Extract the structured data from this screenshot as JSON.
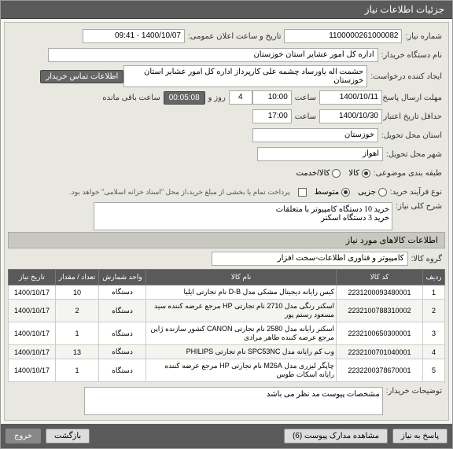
{
  "header": {
    "title": "جزئیات اطلاعات نیاز"
  },
  "fields": {
    "need_number_label": "شماره نیاز:",
    "need_number": "1100000261000082",
    "announce_label": "تاریخ و ساعت اعلان عمومی:",
    "announce_value": "1400/10/07 - 09:41",
    "buyer_org_label": "نام دستگاه خریدار:",
    "buyer_org": "اداره کل امور عشایر استان خوزستان",
    "requester_label": "ایجاد کننده درخواست:",
    "requester": "حشمت اله یاورساد چشمه علی کارپرداز اداره کل امور عشایر استان خوزستان",
    "contact_link": "اطلاعات تماس خریدار",
    "response_deadline_label": "مهلت ارسال پاسخ:",
    "response_date": "1400/10/11",
    "time_label": "ساعت",
    "response_time": "10:00",
    "days_label": "روز و",
    "days_value": "4",
    "remaining_time": "00:05:08",
    "remaining_label": "ساعت باقی مانده",
    "validity_label": "حداقل تاریخ اعتبار قیمت تا تاریخ:",
    "validity_date": "1400/10/30",
    "validity_time": "17:00",
    "province_label": "استان محل تحویل:",
    "province": "خوزستان",
    "city_label": "شهر محل تحویل:",
    "city": "اهواز",
    "category_label": "طبقه بندی موضوعی:",
    "cat_goods": "کالا",
    "cat_service": "کالا/خدمت",
    "purchase_type_label": "نوع فرآیند خرید:",
    "pt_small": "جزیی",
    "pt_medium": "متوسط",
    "pt_note": "پرداخت تمام یا بخشی از مبلغ خرید،از محل \"اسناد خزانه اسلامی\" خواهد بود.",
    "need_title_label": "شرح کلی نیاز:",
    "need_title": "خرید 10 دستگاه کامپیوتر با متعلقات\nخرید 3 دستگاه اسکنر",
    "items_header": "اطلاعات کالاهای مورد نیاز",
    "group_label": "گروه کالا:",
    "group_value": "کامپیوتر و فناوری اطلاعات-سخت افزار",
    "buyer_notes_label": "توضیحات خریدار:",
    "buyer_notes": "مشخصات پیوست مد نظر می باشد"
  },
  "table": {
    "headers": {
      "row": "ردیف",
      "code": "کد کالا",
      "name": "نام کالا",
      "unit": "واحد شمارش",
      "qty": "تعداد / مقدار",
      "date": "تاریخ نیاز"
    },
    "rows": [
      {
        "n": "1",
        "code": "2231200093480001",
        "name": "کیس رایانه دیجیتال مشکی مدل D-B نام تجارتی ایلیا",
        "unit": "دستگاه",
        "qty": "10",
        "date": "1400/10/17"
      },
      {
        "n": "2",
        "code": "2232100788310002",
        "name": "اسکنر رنگی مدل 2710 نام تجارتی HP مرجع عرضه کننده سید مسعود رستم پور",
        "unit": "دستگاه",
        "qty": "2",
        "date": "1400/10/17"
      },
      {
        "n": "3",
        "code": "2232100650300001",
        "name": "اسکنر رایانه مدل 2580 نام تجارتی CANON کشور سازنده ژاپن مرجع عرضه کننده طاهر مرادی",
        "unit": "دستگاه",
        "qty": "1",
        "date": "1400/10/17"
      },
      {
        "n": "4",
        "code": "2232100701040001",
        "name": "وب کم رایانه مدل SPC53NC نام تجارتی PHILIPS",
        "unit": "دستگاه",
        "qty": "13",
        "date": "1400/10/17"
      },
      {
        "n": "5",
        "code": "2232200378670001",
        "name": "چاپگر لیزری مدل M26A نام تجارتی HP مرجع عرضه کننده رایانه اسکات طوس",
        "unit": "دستگاه",
        "qty": "1",
        "date": "1400/10/17"
      }
    ]
  },
  "footer": {
    "back": "پاسخ به نیاز",
    "attachments": "مشاهده مدارک پیوست (6)",
    "return": "بازگشت",
    "exit": "خروج"
  }
}
